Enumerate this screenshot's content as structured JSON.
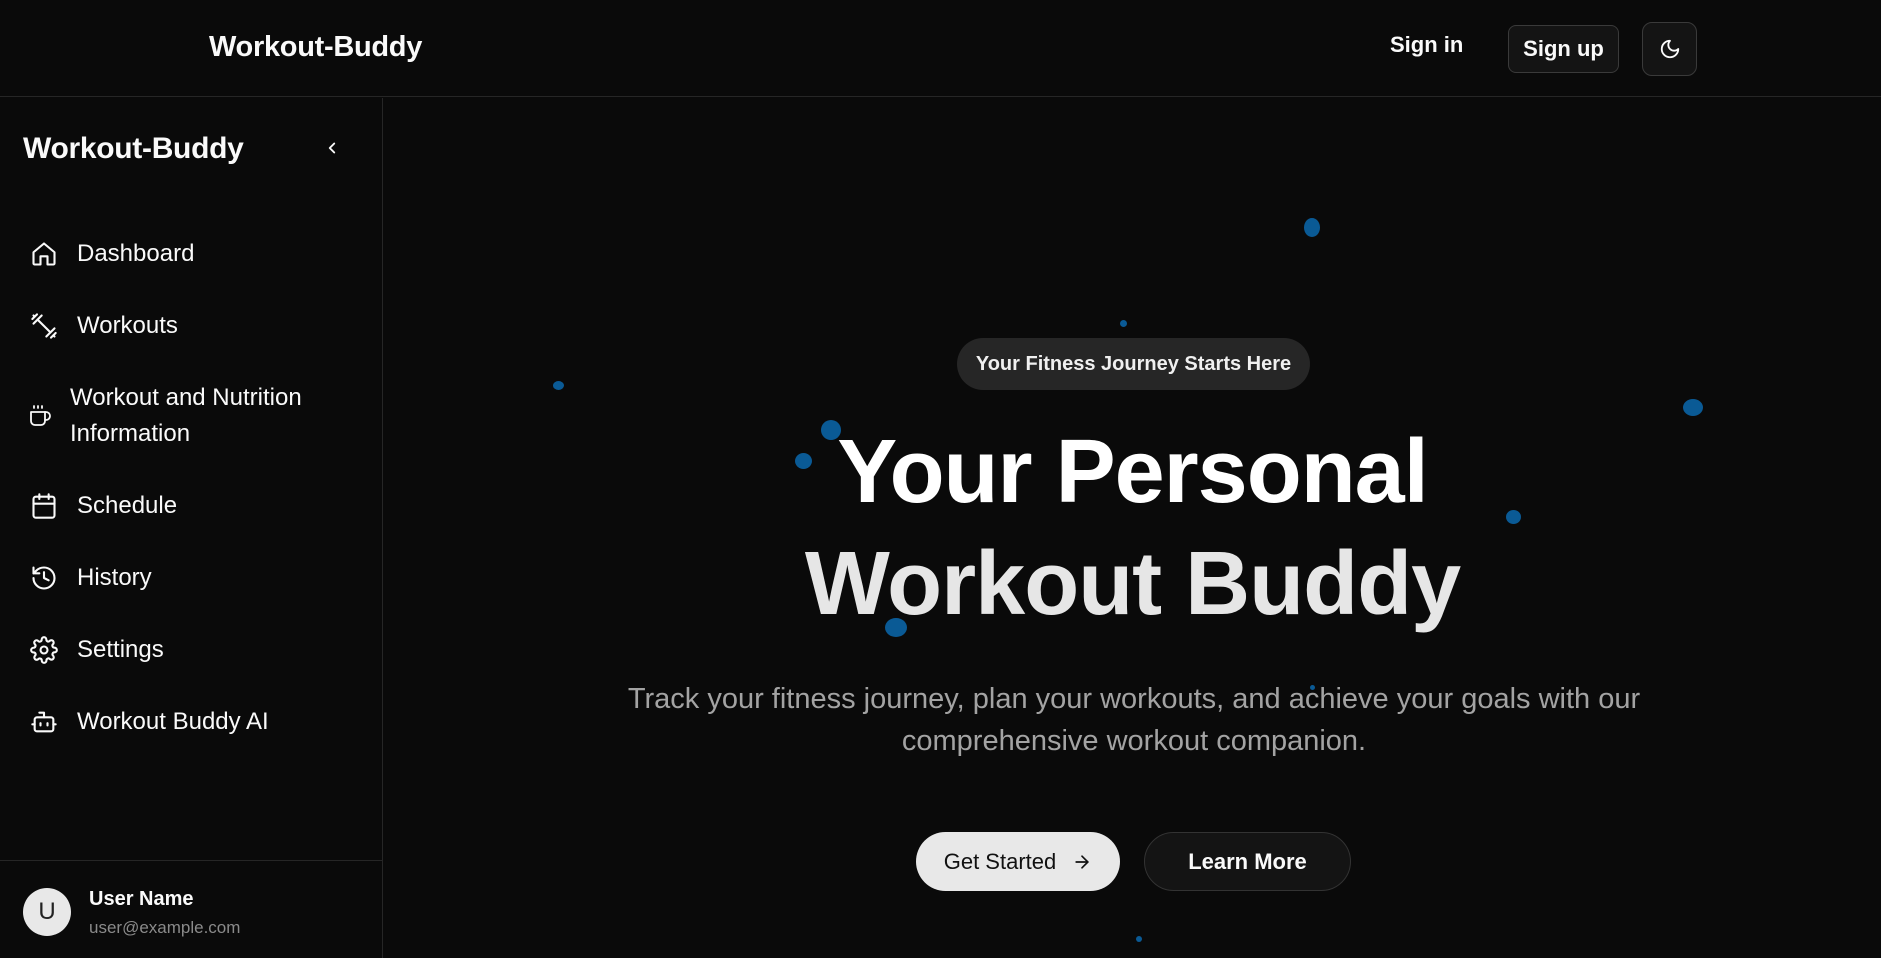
{
  "header": {
    "brand": "Workout-Buddy",
    "sign_in": "Sign in",
    "sign_up": "Sign up",
    "theme_icon": "moon-icon"
  },
  "sidebar": {
    "brand": "Workout-Buddy",
    "collapse_icon": "chevron-left-icon",
    "items": [
      {
        "label": "Dashboard",
        "icon": "home-icon"
      },
      {
        "label": "Workouts",
        "icon": "dumbbell-icon"
      },
      {
        "label": "Workout and Nutrition Information",
        "icon": "coffee-icon"
      },
      {
        "label": "Schedule",
        "icon": "calendar-icon"
      },
      {
        "label": "History",
        "icon": "history-icon"
      },
      {
        "label": "Settings",
        "icon": "gear-icon"
      },
      {
        "label": "Workout Buddy AI",
        "icon": "bot-icon"
      }
    ],
    "user": {
      "initial": "U",
      "name": "User Name",
      "email": "user@example.com"
    }
  },
  "hero": {
    "badge": "Your Fitness Journey Starts Here",
    "title_line1": "Your Personal",
    "title_line2": "Workout Buddy",
    "subtitle": "Track your fitness journey, plan your workouts, and achieve your goals with our comprehensive workout companion.",
    "primary_button": "Get Started",
    "secondary_button": "Learn More"
  },
  "colors": {
    "background": "#0a0a0a",
    "border": "#262626",
    "particle": "#0a5a95",
    "muted_text": "#a3a3a3"
  }
}
